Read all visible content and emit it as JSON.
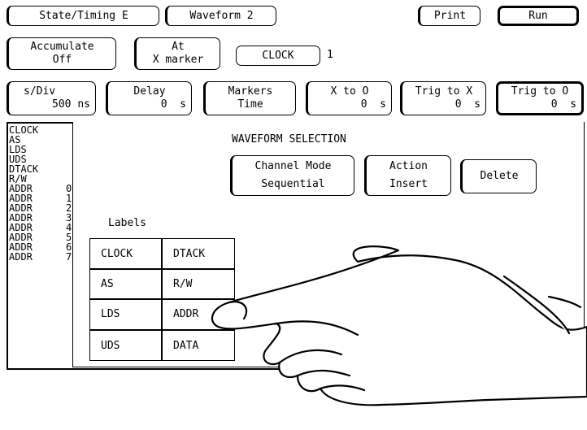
{
  "top_bar": {
    "mode_label": "State/Timing E",
    "menu_label": "Waveform 2",
    "print_label": "Print",
    "run_label": "Run"
  },
  "control_bar": {
    "accumulate_line1": "Accumulate",
    "accumulate_line2": "Off",
    "at_line1": "At",
    "at_line2": "X marker",
    "clock_label": "CLOCK",
    "clock_value": "1"
  },
  "timebase_bar": {
    "s_div": {
      "label": "s/Div",
      "value": "500 ns"
    },
    "delay": {
      "label": "Delay",
      "value": "0  s"
    },
    "markers": {
      "label": "Markers",
      "value": "Time"
    },
    "x_to_o": {
      "label": "X to O",
      "value": "0  s"
    },
    "trig_to_x": {
      "label": "Trig to X",
      "value": "0  s"
    },
    "trig_to_o": {
      "label": "Trig to O",
      "value": "0  s"
    }
  },
  "signal_list": [
    {
      "label": "CLOCK",
      "num": ""
    },
    {
      "label": "AS",
      "num": ""
    },
    {
      "label": "LDS",
      "num": ""
    },
    {
      "label": "UDS",
      "num": ""
    },
    {
      "label": "DTACK",
      "num": ""
    },
    {
      "label": "R/W",
      "num": ""
    },
    {
      "label": "ADDR",
      "num": "0"
    },
    {
      "label": "ADDR",
      "num": "1"
    },
    {
      "label": "ADDR",
      "num": "2"
    },
    {
      "label": "ADDR",
      "num": "3"
    },
    {
      "label": "ADDR",
      "num": "4"
    },
    {
      "label": "ADDR",
      "num": "5"
    },
    {
      "label": "ADDR",
      "num": "6"
    },
    {
      "label": "ADDR",
      "num": "7"
    }
  ],
  "waveform_selection": {
    "title": "WAVEFORM SELECTION",
    "channel_mode": {
      "line1": "Channel Mode",
      "line2": "Sequential"
    },
    "action": {
      "line1": "Action",
      "line2": "Insert"
    },
    "delete_label": "Delete",
    "labels_title": "Labels",
    "labels": [
      [
        "CLOCK",
        "DTACK"
      ],
      [
        "AS",
        "R/W"
      ],
      [
        "LDS",
        "ADDR"
      ],
      [
        "UDS",
        "DATA"
      ]
    ]
  }
}
